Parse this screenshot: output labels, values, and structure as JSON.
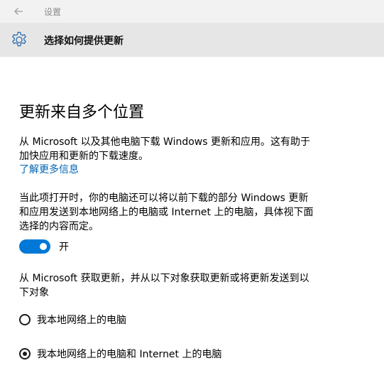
{
  "titlebar": {
    "back_icon": "arrow-left-icon",
    "title": "设置"
  },
  "header": {
    "icon": "gear-icon",
    "title": "选择如何提供更新"
  },
  "main": {
    "heading": "更新来自多个位置",
    "description_line1": "从 Microsoft 以及其他电脑下载 Windows 更新和应用。这有助于",
    "description_line2": "加快应用和更新的下载速度。",
    "learn_more_link": "了解更多信息",
    "toggle_desc_line1": "当此项打开时，你的电脑还可以将以前下载的部分 Windows 更新",
    "toggle_desc_line2": "和应用发送到本地网络上的电脑或 Internet 上的电脑，具体视下面",
    "toggle_desc_line3": "选择的内容而定。",
    "toggle": {
      "state": "on",
      "label": "开"
    },
    "source_desc_line1": "从 Microsoft 获取更新，并从以下对象获取更新或将更新发送到以",
    "source_desc_line2": "下对象",
    "options": [
      {
        "label": "我本地网络上的电脑",
        "selected": false
      },
      {
        "label": "我本地网络上的电脑和 Internet 上的电脑",
        "selected": true
      }
    ]
  },
  "colors": {
    "accent": "#0078d7",
    "link": "#0063b1",
    "titlebar_bg": "#f2f2f2",
    "header_bg": "#e6e6e6"
  }
}
